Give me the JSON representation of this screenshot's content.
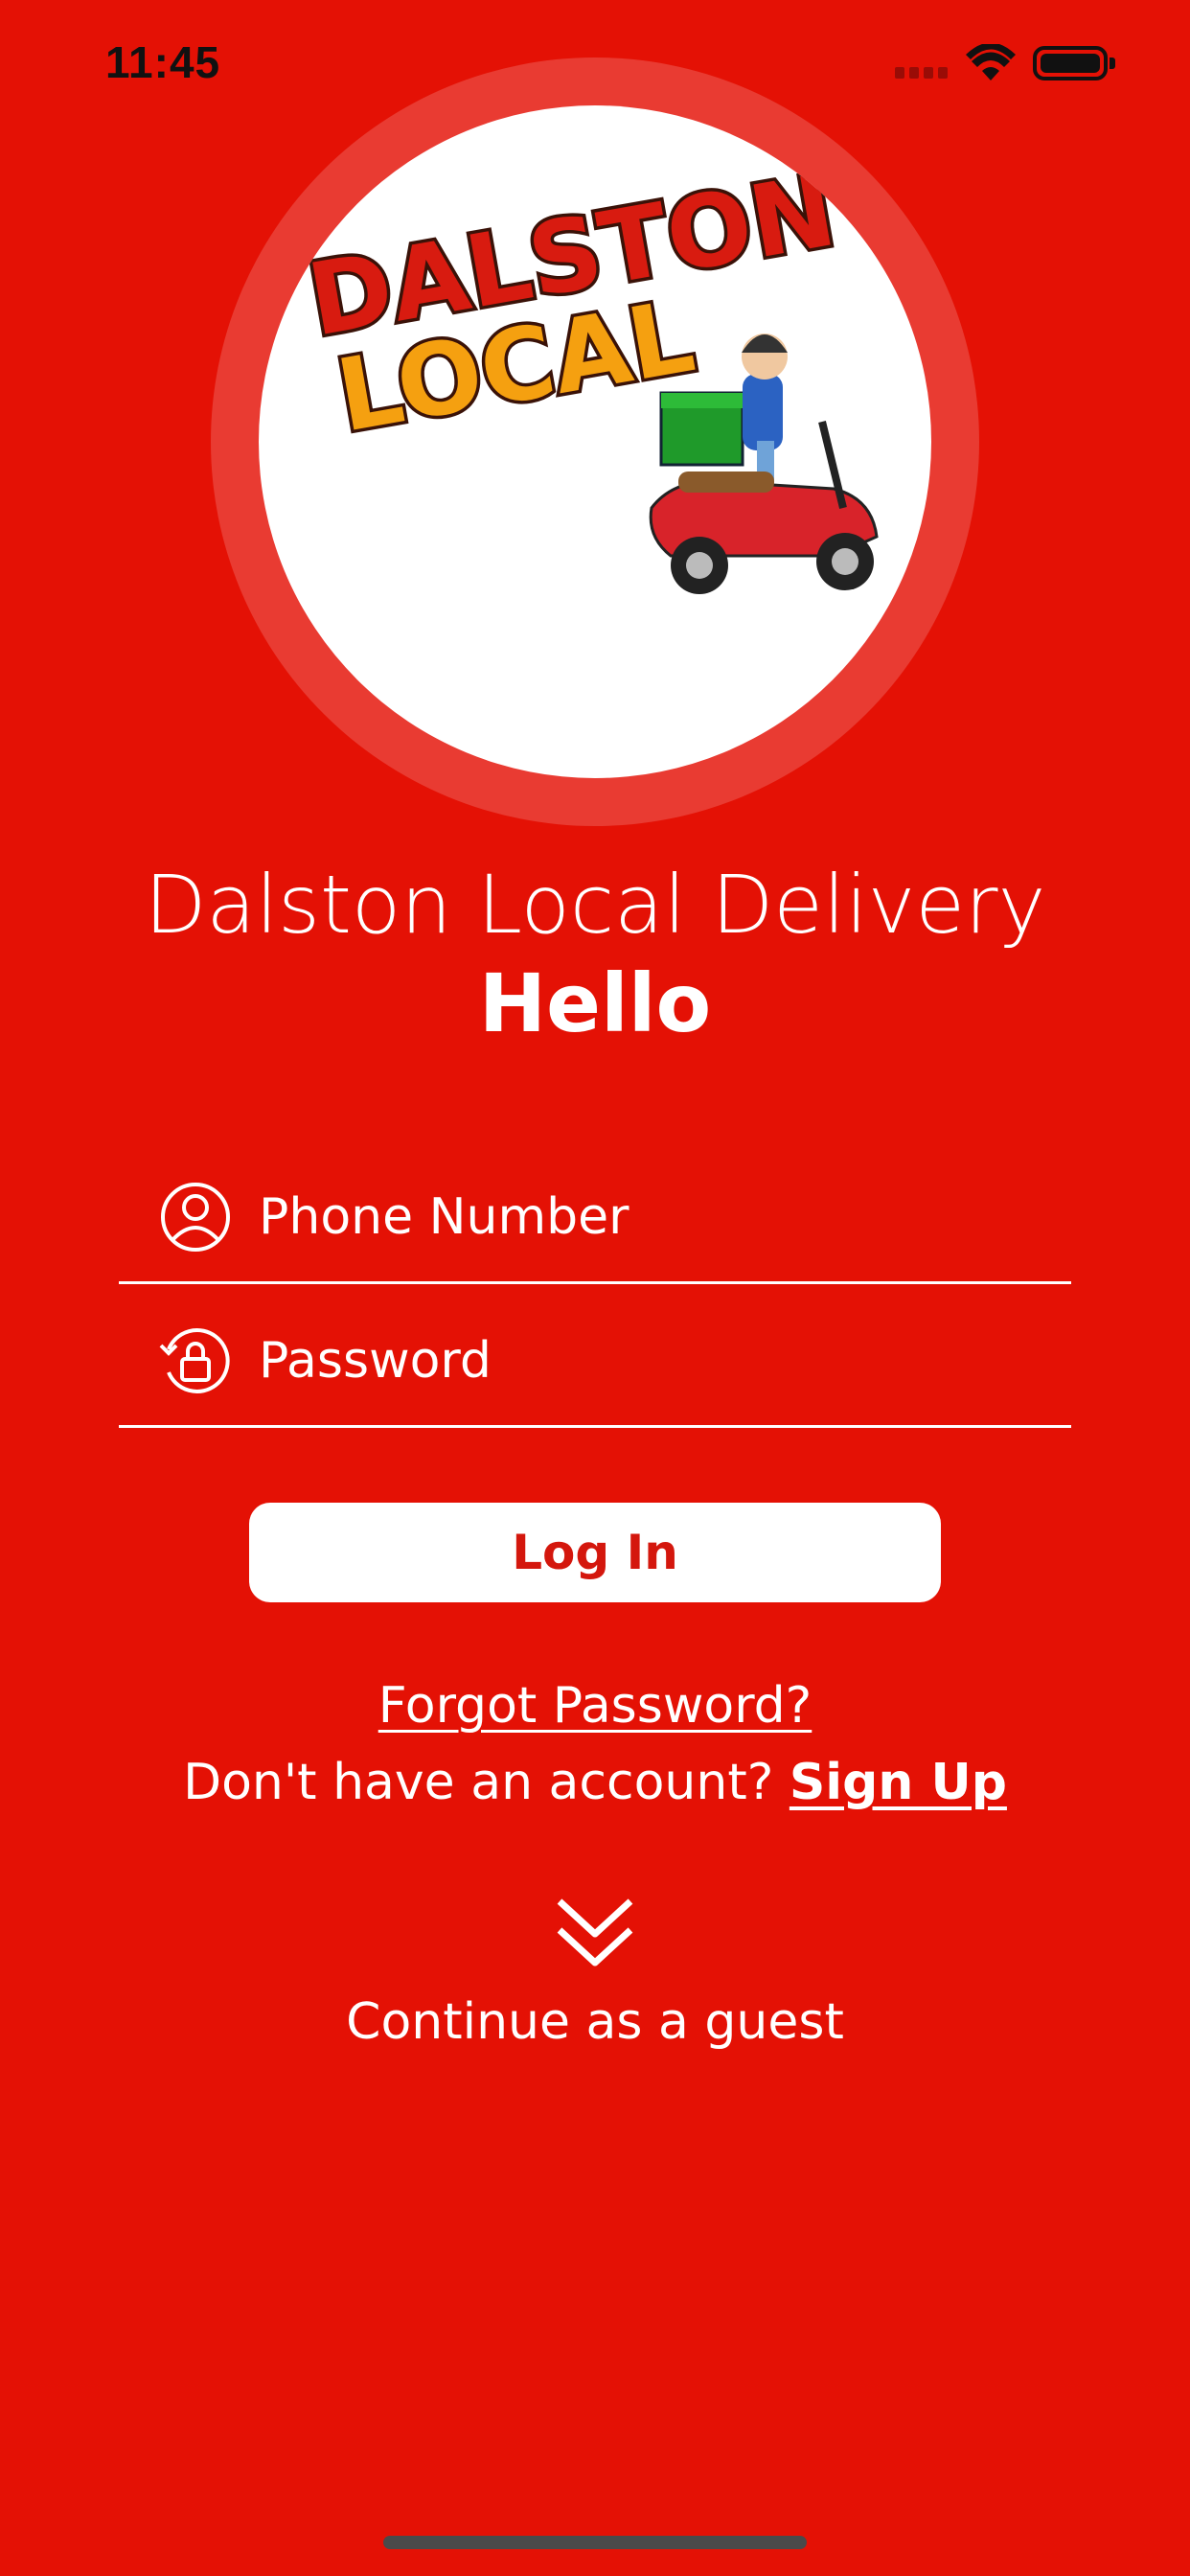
{
  "status_bar": {
    "time": "11:45"
  },
  "logo": {
    "line1": "DALSTON",
    "line2": "LOCAL"
  },
  "header": {
    "app_title": "Dalston Local Delivery",
    "greeting": "Hello"
  },
  "form": {
    "phone_placeholder": "Phone Number",
    "password_placeholder": "Password",
    "login_label": "Log In"
  },
  "links": {
    "forgot_password": "Forgot Password?",
    "no_account": "Don't have an account?",
    "sign_up": "Sign Up"
  },
  "guest": {
    "label": "Continue as a guest"
  },
  "colors": {
    "background": "#e41105",
    "accent_text": "#d4170d",
    "foreground": "#ffffff"
  },
  "icons": {
    "phone_field": "user-circle-icon",
    "password_field": "lock-rotate-icon",
    "guest": "double-chevron-down-icon"
  }
}
